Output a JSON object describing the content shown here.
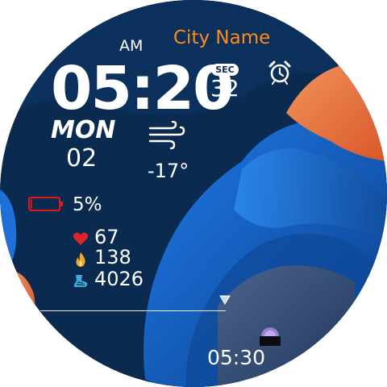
{
  "city": "City Name",
  "ampm": "AM",
  "time": "05:20",
  "sec_label": "SEC",
  "seconds": "32",
  "day": "MON",
  "date": "02",
  "weather": {
    "icon": "wind-icon",
    "temperature": "-17°"
  },
  "battery": {
    "icon": "battery-icon",
    "percent_text": "5%",
    "level_percent": 5,
    "color": "#e01818"
  },
  "metrics": {
    "heart_rate": "67",
    "calories": "138",
    "steps": "4026"
  },
  "sun": {
    "time": "05:30",
    "icon": "sunrise-icon"
  },
  "alarm_icon": "alarm-clock-icon",
  "colors": {
    "accent": "#ff8a1c",
    "background": "#0b2a4f",
    "heart": "#e0222a",
    "flame": "#f5a623",
    "steps": "#3fa9d8"
  }
}
